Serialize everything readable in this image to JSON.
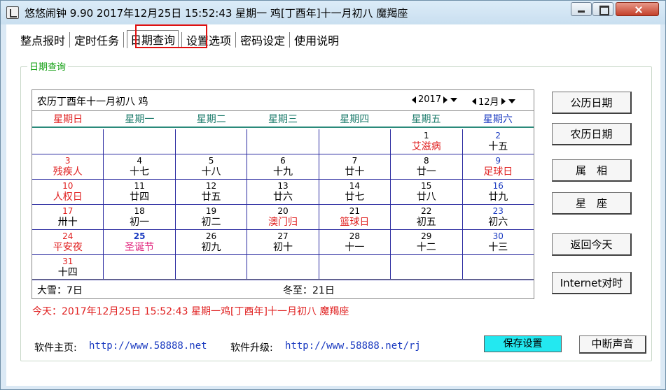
{
  "window": {
    "title": "悠悠闹钟 9.90 2017年12月25日 15:52:43 星期一 鸡[丁酉年]十一月初八 魔羯座"
  },
  "tabs": [
    {
      "label": "整点报时"
    },
    {
      "label": "定时任务"
    },
    {
      "label": "日期查询",
      "active": true
    },
    {
      "label": "设置选项"
    },
    {
      "label": "密码设定"
    },
    {
      "label": "使用说明"
    }
  ],
  "group": {
    "title": "日期查询"
  },
  "calendar": {
    "lunar_header": "农历丁酉年十一月初八 鸡",
    "year": "2017",
    "month": "12月",
    "weekdays": [
      "星期日",
      "星期一",
      "星期二",
      "星期三",
      "星期四",
      "星期五",
      "星期六"
    ],
    "weeks": [
      [
        {
          "d": "",
          "l": ""
        },
        {
          "d": "",
          "l": ""
        },
        {
          "d": "",
          "l": ""
        },
        {
          "d": "",
          "l": ""
        },
        {
          "d": "",
          "l": ""
        },
        {
          "d": "1",
          "l": "艾滋病",
          "lc": "red"
        },
        {
          "d": "2",
          "l": "十五",
          "dc": "blue"
        }
      ],
      [
        {
          "d": "3",
          "l": "残疾人",
          "dc": "red",
          "lc": "red"
        },
        {
          "d": "4",
          "l": "十七"
        },
        {
          "d": "5",
          "l": "十八"
        },
        {
          "d": "6",
          "l": "十九"
        },
        {
          "d": "7",
          "l": "廿十"
        },
        {
          "d": "8",
          "l": "廿一"
        },
        {
          "d": "9",
          "l": "足球日",
          "dc": "blue",
          "lc": "red"
        }
      ],
      [
        {
          "d": "10",
          "l": "人权日",
          "dc": "red",
          "lc": "red"
        },
        {
          "d": "11",
          "l": "廿四"
        },
        {
          "d": "12",
          "l": "廿五"
        },
        {
          "d": "13",
          "l": "廿六"
        },
        {
          "d": "14",
          "l": "廿七"
        },
        {
          "d": "15",
          "l": "廿八"
        },
        {
          "d": "16",
          "l": "廿九",
          "dc": "blue"
        }
      ],
      [
        {
          "d": "17",
          "l": "卅十",
          "dc": "red"
        },
        {
          "d": "18",
          "l": "初一"
        },
        {
          "d": "19",
          "l": "初二"
        },
        {
          "d": "20",
          "l": "澳门归",
          "lc": "red"
        },
        {
          "d": "21",
          "l": "篮球日",
          "lc": "red"
        },
        {
          "d": "22",
          "l": "初五"
        },
        {
          "d": "23",
          "l": "初六",
          "dc": "blue"
        }
      ],
      [
        {
          "d": "24",
          "l": "平安夜",
          "dc": "red",
          "lc": "red"
        },
        {
          "d": "25",
          "l": "圣诞节",
          "dc": "blue",
          "lc": "pink",
          "bold": true
        },
        {
          "d": "26",
          "l": "初九"
        },
        {
          "d": "27",
          "l": "初十"
        },
        {
          "d": "28",
          "l": "十一"
        },
        {
          "d": "29",
          "l": "十二"
        },
        {
          "d": "30",
          "l": "十三",
          "dc": "blue"
        }
      ],
      [
        {
          "d": "31",
          "l": "十四",
          "dc": "red"
        },
        {
          "d": "",
          "l": ""
        },
        {
          "d": "",
          "l": ""
        },
        {
          "d": "",
          "l": ""
        },
        {
          "d": "",
          "l": ""
        },
        {
          "d": "",
          "l": ""
        },
        {
          "d": "",
          "l": ""
        }
      ]
    ],
    "solar_term_1": "大雪：7日",
    "solar_term_2": "冬至：21日"
  },
  "today_line": "今天：2017年12月25日 15:52:43 星期一鸡[丁酉年]十一月初八 魔羯座",
  "side_buttons": {
    "gregorian": "公历日期",
    "lunar": "农历日期",
    "zodiac": "属　相",
    "constellation": "星　座",
    "back_today": "返回今天",
    "internet_time": "Internet对时"
  },
  "footer": {
    "home_label": "软件主页:",
    "home_url": "http://www.58888.net",
    "upgrade_label": "软件升级:",
    "upgrade_url": "http://www.58888.net/rj",
    "save_button": "保存设置",
    "stop_button": "中断声音"
  },
  "colors": {
    "accent_red": "#e02020",
    "saturday_blue": "#1a3ac0",
    "save_button_cyan": "#23e8f0",
    "group_title_green": "#14a014"
  }
}
